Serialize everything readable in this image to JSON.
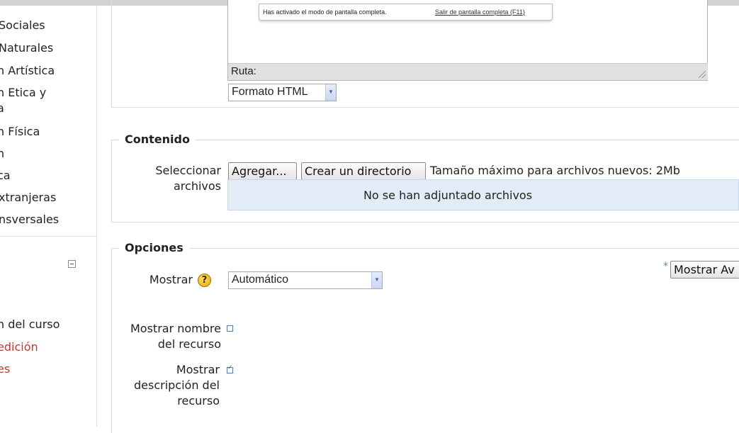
{
  "sidebar": {
    "categories": [
      "Sociales",
      "Naturales",
      "n Artística",
      "n Etica y",
      "a",
      "n Física",
      "n",
      "ca",
      "xtranjeras",
      "nsversales"
    ],
    "admin_links": [
      "n del curso",
      "edición",
      "es"
    ],
    "collapse_symbol": "−"
  },
  "editor": {
    "status_path_label": "Ruta:",
    "fullscreen_notice": "Has activado el modo de pantalla completa.",
    "fullscreen_exit_link": "Salir de pantalla completa (F11)",
    "format_value": "Formato HTML"
  },
  "contenido": {
    "legend": "Contenido",
    "select_files_label": "Seleccionar archivos",
    "add_button": "Agregar...",
    "create_dir_button": "Crear un directorio",
    "max_size_text": "Tamaño máximo para archivos nuevos: 2Mb",
    "no_files_text": "No se han adjuntado archivos"
  },
  "opciones": {
    "legend": "Opciones",
    "show_advanced_button": "Mostrar Av",
    "asterisk": "*",
    "mostrar_label": "Mostrar",
    "help_symbol": "?",
    "mostrar_value": "Automático",
    "show_name_label": "Mostrar nombre del recurso",
    "show_name_checked": false,
    "show_description_label": "Mostrar descripción del recurso",
    "show_description_checked": true
  },
  "colors": {
    "link_red": "#c0392b",
    "files_box_bg": "#e2ecf6",
    "asterisk_green": "#44aa44"
  }
}
